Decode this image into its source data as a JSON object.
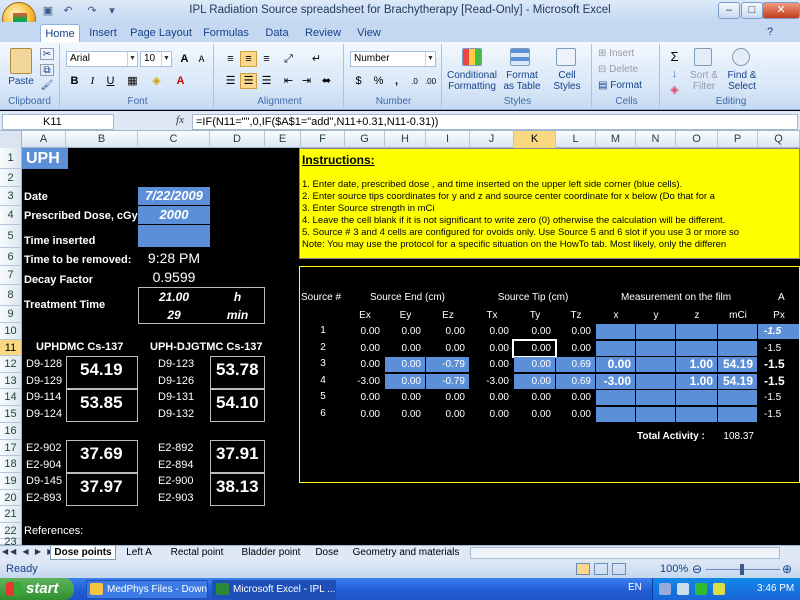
{
  "window": {
    "title": "IPL Radiation Source spreadsheet for Brachytherapy  [Read-Only] - Microsoft Excel"
  },
  "ribbon": {
    "tabs": [
      "Home",
      "Insert",
      "Page Layout",
      "Formulas",
      "Data",
      "Review",
      "View"
    ],
    "clipboard": {
      "label": "Clipboard",
      "paste": "Paste"
    },
    "font": {
      "label": "Font",
      "name": "Arial",
      "size": "10",
      "bold": "B",
      "italic": "I",
      "underline": "U"
    },
    "alignment": {
      "label": "Alignment"
    },
    "number": {
      "label": "Number",
      "format": "Number",
      "currency": "$",
      "percent": "%",
      "comma": ","
    },
    "styles": {
      "label": "Styles",
      "conditional": "Conditional Formatting",
      "format_table": "Format as Table",
      "cell_styles": "Cell Styles"
    },
    "cells": {
      "label": "Cells",
      "insert": "Insert",
      "delete": "Delete",
      "format": "Format"
    },
    "editing": {
      "label": "Editing",
      "sort": "Sort & Filter",
      "find": "Find & Select"
    }
  },
  "formula_bar": {
    "name_box": "K11",
    "fx": "fx",
    "formula": "=IF(N11=\"\",0,IF($A$1=\"add\",N11+0.31,N11-0.31))"
  },
  "columns": [
    "A",
    "B",
    "C",
    "D",
    "E",
    "F",
    "G",
    "H",
    "I",
    "J",
    "K",
    "L",
    "M",
    "N",
    "O",
    "P",
    "Q"
  ],
  "rows": [
    "1",
    "2",
    "3",
    "4",
    "5",
    "6",
    "7",
    "8",
    "9",
    "10",
    "11",
    "12",
    "13",
    "14",
    "15",
    "16",
    "17",
    "18",
    "19",
    "20",
    "21",
    "22",
    "23"
  ],
  "sheet": {
    "title": "UPH",
    "date_label": "Date",
    "date_value": "7/22/2009",
    "dose_label": "Prescribed Dose, cGy",
    "dose_value": "2000",
    "time_inserted_label": "Time inserted",
    "time_removed_label": "Time to be removed:",
    "time_removed_value": "9:28 PM",
    "decay_label": "Decay Factor",
    "decay_value": "0.9599",
    "treatment_label": "Treatment Time",
    "treatment_h": "21.00",
    "h_unit": "h",
    "treatment_min": "29",
    "min_unit": "min",
    "uph_header": "UPHDMC Cs-137",
    "uph2_header": "UPH-DJGTMC Cs-137",
    "left_sources": [
      {
        "ids": [
          "D9-128",
          "D9-129"
        ],
        "value": "54.19"
      },
      {
        "ids": [
          "D9-114",
          "D9-124"
        ],
        "value": "53.85"
      },
      {
        "ids": [
          "E2-902",
          "E2-904"
        ],
        "value": "37.69"
      },
      {
        "ids": [
          "D9-145",
          "E2-893"
        ],
        "value": "37.97"
      }
    ],
    "right_sources": [
      {
        "ids": [
          "D9-123",
          "D9-126"
        ],
        "value": "53.78"
      },
      {
        "ids": [
          "D9-131",
          "D9-132"
        ],
        "value": "54.10"
      },
      {
        "ids": [
          "E2-892",
          "E2-894"
        ],
        "value": "37.91"
      },
      {
        "ids": [
          "E2-900",
          "E2-903"
        ],
        "value": "38.13"
      }
    ],
    "references_label": "References:",
    "instructions": {
      "title": "Instructions:",
      "lines": [
        "1.  Enter date, prescribed dose , and time inserted on the upper left side corner (blue cells).",
        "2.  Enter source tips coordinates for y and z and source center coordinate for x below (Do that for  a",
        "3.  Enter Source strength in mCi",
        "4.  Leave the cell blank if it is not significant to write zero (0) otherwise the calculation will be different.",
        "5.  Source # 3 and 4 cells are configured for ovoids only.  Use Source 5 and 6 slot if you use 3 or more so",
        "Note:  You may use the protocol for a specific situation on the HowTo tab.  Most likely, only the differen"
      ]
    },
    "table": {
      "group_headers": [
        "Source #",
        "Source End (cm)",
        "Source Tip (cm)",
        "Measurement on the film",
        "A"
      ],
      "sub_headers": [
        "Ex",
        "Ey",
        "Ez",
        "Tx",
        "Ty",
        "Tz",
        "x",
        "y",
        "z",
        "mCi",
        "Px"
      ],
      "rows": [
        {
          "n": "1",
          "ex": "0.00",
          "ey": "0.00",
          "ez": "0.00",
          "tx": "0.00",
          "ty": "0.00",
          "tz": "0.00",
          "x": "",
          "y": "",
          "z": "",
          "mci": "",
          "px": "-1.5"
        },
        {
          "n": "2",
          "ex": "0.00",
          "ey": "0.00",
          "ez": "0.00",
          "tx": "0.00",
          "ty": "0.00",
          "tz": "0.00",
          "x": "",
          "y": "",
          "z": "",
          "mci": "",
          "px": "-1.5"
        },
        {
          "n": "3",
          "ex": "0.00",
          "ey": "0.00",
          "ez": "-0.79",
          "tx": "0.00",
          "ty": "0.00",
          "tz": "0.69",
          "x": "0.00",
          "y": "",
          "z": "1.00",
          "mci": "54.19",
          "px": "-1.5"
        },
        {
          "n": "4",
          "ex": "-3.00",
          "ey": "0.00",
          "ez": "-0.79",
          "tx": "-3.00",
          "ty": "0.00",
          "tz": "0.69",
          "x": "-3.00",
          "y": "",
          "z": "1.00",
          "mci": "54.19",
          "px": "-1.5"
        },
        {
          "n": "5",
          "ex": "0.00",
          "ey": "0.00",
          "ez": "0.00",
          "tx": "0.00",
          "ty": "0.00",
          "tz": "0.00",
          "x": "",
          "y": "",
          "z": "",
          "mci": "",
          "px": "-1.5"
        },
        {
          "n": "6",
          "ex": "0.00",
          "ey": "0.00",
          "ez": "0.00",
          "tx": "0.00",
          "ty": "0.00",
          "tz": "0.00",
          "x": "",
          "y": "",
          "z": "",
          "mci": "",
          "px": "-1.5"
        }
      ],
      "total_label": "Total Activity :",
      "total_value": "108.37"
    }
  },
  "sheet_tabs": [
    "Dose points",
    "Left A",
    "Rectal point",
    "Bladder point",
    "Dose",
    "Geometry and materials"
  ],
  "status": {
    "ready": "Ready",
    "zoom": "100%"
  },
  "taskbar": {
    "start": "start",
    "tasks": [
      "MedPhys Files - Down...",
      "Microsoft Excel - IPL ..."
    ],
    "lang": "EN",
    "clock": "3:46 PM"
  },
  "colors": {
    "cell_blue": "#5b8fd8",
    "instructions_yellow": "#ffff00",
    "sheet_bg": "#000000"
  }
}
